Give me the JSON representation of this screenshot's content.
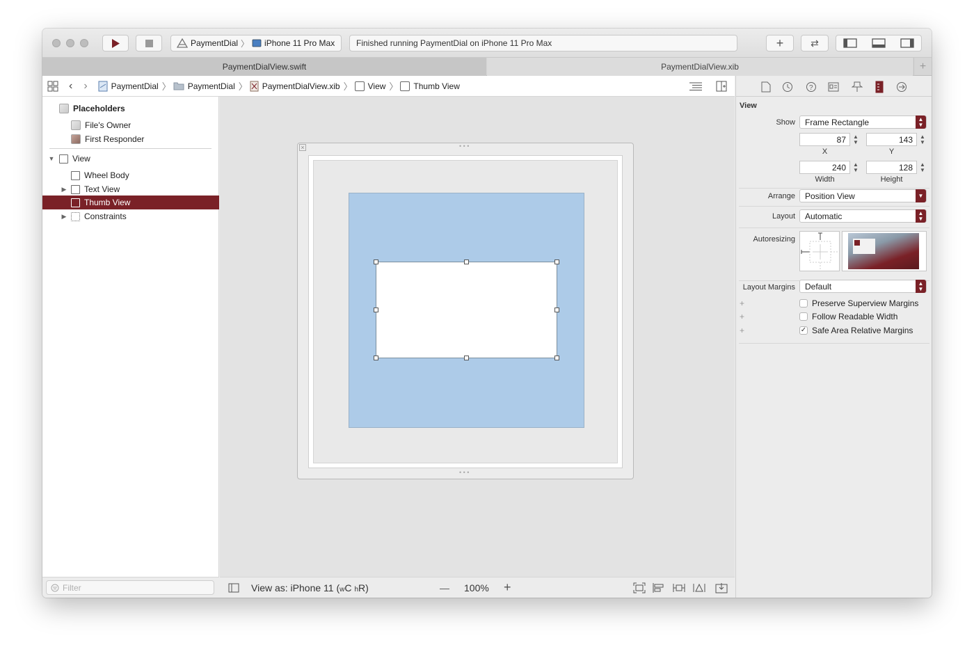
{
  "toolbar": {
    "scheme_name": "PaymentDial",
    "device_name": "iPhone 11 Pro Max",
    "status_text": "Finished running PaymentDial on iPhone 11 Pro Max",
    "run_icon": "play-icon",
    "stop_icon": "stop-icon",
    "library_icon": "plus-icon",
    "review_icon": "swap-arrows-icon"
  },
  "tabs": [
    {
      "label": "PaymentDialView.swift",
      "active": true
    },
    {
      "label": "PaymentDialView.xib",
      "active": false
    }
  ],
  "jumpbar": {
    "crumbs": [
      "PaymentDial",
      "PaymentDial",
      "PaymentDialView.xib",
      "View",
      "Thumb View"
    ]
  },
  "outline": {
    "placeholders_label": "Placeholders",
    "files_owner": "File's Owner",
    "first_responder": "First Responder",
    "view_label": "View",
    "items": [
      "Wheel Body",
      "Text View",
      "Thumb View",
      "Constraints"
    ],
    "filter_placeholder": "Filter"
  },
  "canvas": {
    "view_as_prefix": "View as: iPhone 11 (",
    "size_w": "w",
    "size_w_class": "C",
    "size_h": "h",
    "size_h_class": "R",
    "view_as_suffix": ")",
    "zoom": "100%",
    "zoom_out": "—",
    "zoom_in": "+"
  },
  "inspector": {
    "section_title": "View",
    "show_label": "Show",
    "show_value": "Frame Rectangle",
    "x_value": "87",
    "y_value": "143",
    "x_label": "X",
    "y_label": "Y",
    "width_value": "240",
    "height_value": "128",
    "width_label": "Width",
    "height_label": "Height",
    "arrange_label": "Arrange",
    "arrange_value": "Position View",
    "layout_label": "Layout",
    "layout_value": "Automatic",
    "autoresizing_label": "Autoresizing",
    "margins_label": "Layout Margins",
    "margins_value": "Default",
    "checkboxes": [
      {
        "label": "Preserve Superview Margins",
        "checked": false
      },
      {
        "label": "Follow Readable Width",
        "checked": false
      },
      {
        "label": "Safe Area Relative Margins",
        "checked": true
      }
    ]
  },
  "colors": {
    "accent": "#7a2127",
    "canvas_wheel": "#adcbe8"
  }
}
